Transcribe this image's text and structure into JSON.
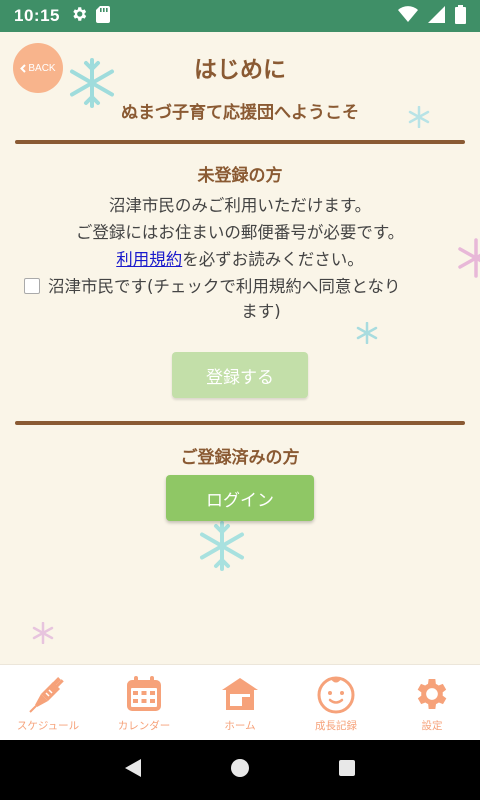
{
  "status_bar": {
    "time": "10:15",
    "icons": [
      "gear-icon",
      "sdcard-icon",
      "wifi-icon",
      "signal-icon",
      "battery-icon"
    ]
  },
  "header": {
    "back_label": "BACK",
    "title": "はじめに",
    "subtitle": "ぬまづ子育て応援団へようこそ"
  },
  "unregistered": {
    "heading": "未登録の方",
    "line1": "沼津市民のみご利用いただけます。",
    "line2": "ご登録にはお住まいの郵便番号が必要です。",
    "terms_link": "利用規約",
    "terms_suffix": "を必ずお読みください。",
    "checkbox_line1": "沼津市民です(チェックで利用規約へ同意となり",
    "checkbox_line2": "ます)",
    "checkbox_checked": false,
    "register_button": "登録する"
  },
  "registered": {
    "heading": "ご登録済みの方",
    "login_button": "ログイン"
  },
  "tabs": [
    {
      "label": "スケジュール",
      "icon": "syringe-icon"
    },
    {
      "label": "カレンダー",
      "icon": "calendar-icon"
    },
    {
      "label": "ホーム",
      "icon": "home-icon"
    },
    {
      "label": "成長記録",
      "icon": "baby-face-icon"
    },
    {
      "label": "設定",
      "icon": "gear-icon"
    }
  ],
  "colors": {
    "status_bar": "#3f8f67",
    "heading_brown": "#8a5a33",
    "back_button": "#f8b48c",
    "register_button_disabled": "#c3dfa9",
    "login_button": "#8fc765",
    "tab_icon": "#f6a27a"
  }
}
